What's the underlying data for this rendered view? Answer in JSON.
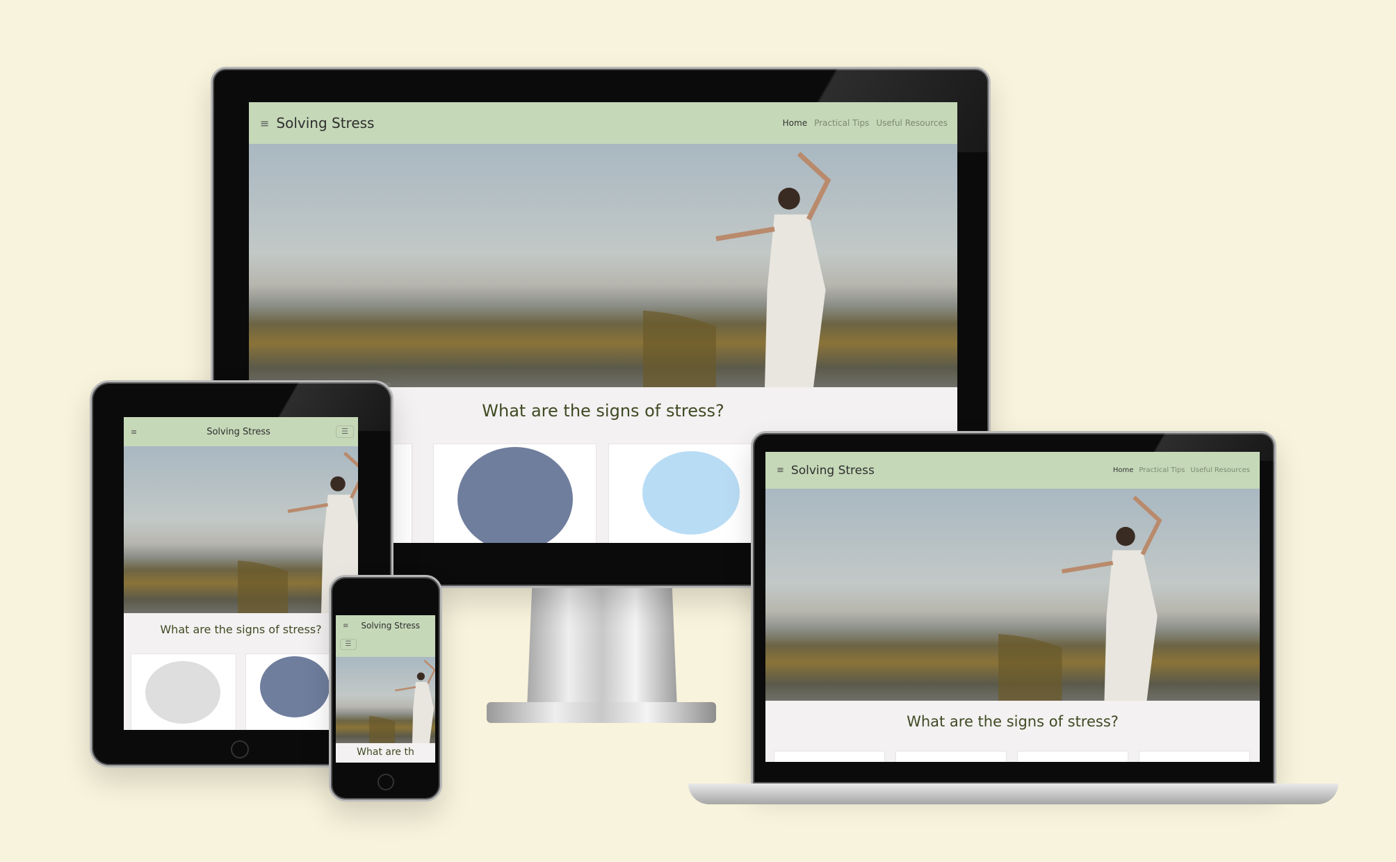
{
  "site": {
    "brand": "Solving Stress",
    "nav": [
      {
        "label": "Home",
        "active": true
      },
      {
        "label": "Practical Tips"
      },
      {
        "label": "Useful Resources"
      }
    ],
    "heading": "What are the signs of stress?",
    "menu_icon": "hamburger-icon",
    "phone_heading_partial": "What are th"
  },
  "colors": {
    "background": "#f8f3dc",
    "navbar": "#c5d8b8",
    "heading": "#3f4a24"
  }
}
